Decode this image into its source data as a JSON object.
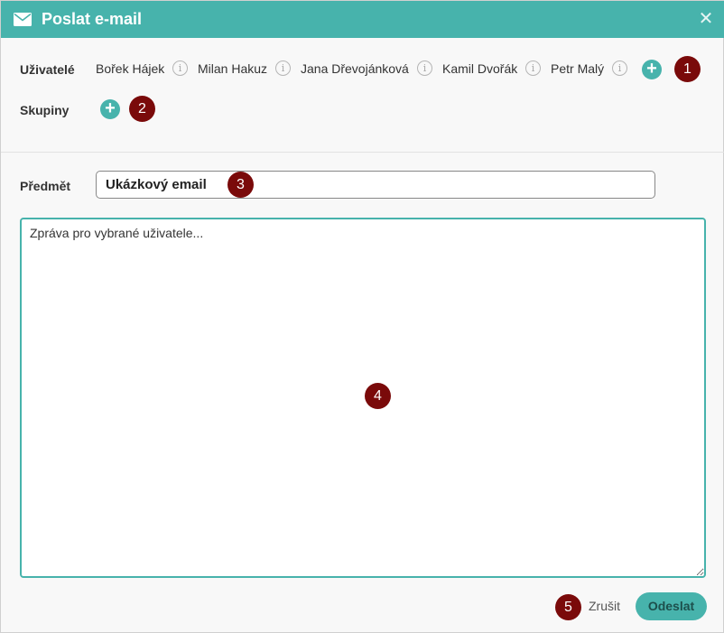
{
  "dialog": {
    "title": "Poslat e-mail",
    "icons": {
      "title": "envelope-icon",
      "close": "close-icon"
    }
  },
  "recipients": {
    "users_label": "Uživatelé",
    "users": [
      {
        "name": "Bořek Hájek"
      },
      {
        "name": "Milan Hakuz"
      },
      {
        "name": "Jana Dřevojánková"
      },
      {
        "name": "Kamil Dvořák"
      },
      {
        "name": "Petr Malý"
      }
    ],
    "groups_label": "Skupiny",
    "add_symbol": "+",
    "info_symbol": "i"
  },
  "form": {
    "subject_label": "Předmět",
    "subject_value": "Ukázkový email",
    "message_value": "Zpráva pro vybrané uživatele..."
  },
  "footer": {
    "cancel_label": "Zrušit",
    "send_label": "Odeslat"
  },
  "annotations": [
    "1",
    "2",
    "3",
    "4",
    "5"
  ],
  "colors": {
    "accent": "#47b3ac",
    "badge": "#7a0a0a"
  }
}
